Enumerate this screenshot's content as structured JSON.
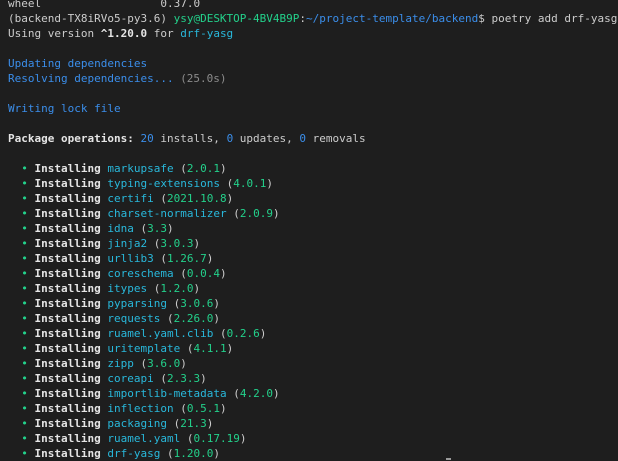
{
  "wheel_line": {
    "name": "wheel",
    "version": "0.37.0"
  },
  "prompt": {
    "venv": "(backend-TX8iRVo5-py3.6)",
    "user_host": "ysy@DESKTOP-4BV4B9P",
    "colon": ":",
    "path": "~/project-template/backend",
    "dollar": "$",
    "command": "poetry add drf-yasg"
  },
  "using": {
    "prefix": "Using version ",
    "constraint": "^1.20.0",
    "middle": " for ",
    "package": "drf-yasg"
  },
  "updating": "Updating dependencies",
  "resolving": {
    "text": "Resolving dependencies... ",
    "time": "(25.0s)"
  },
  "writing": "Writing lock file",
  "operations": {
    "label": "Package operations: ",
    "installs": "20",
    "installs_label": " installs, ",
    "updates": "0",
    "updates_label": " updates, ",
    "removals": "0",
    "removals_label": " removals"
  },
  "install_word": "Installing",
  "bullet": "•",
  "packages": [
    {
      "name": "markupsafe",
      "version": "2.0.1"
    },
    {
      "name": "typing-extensions",
      "version": "4.0.1"
    },
    {
      "name": "certifi",
      "version": "2021.10.8"
    },
    {
      "name": "charset-normalizer",
      "version": "2.0.9"
    },
    {
      "name": "idna",
      "version": "3.3"
    },
    {
      "name": "jinja2",
      "version": "3.0.3"
    },
    {
      "name": "urllib3",
      "version": "1.26.7"
    },
    {
      "name": "coreschema",
      "version": "0.0.4"
    },
    {
      "name": "itypes",
      "version": "1.2.0"
    },
    {
      "name": "pyparsing",
      "version": "3.0.6"
    },
    {
      "name": "requests",
      "version": "2.26.0"
    },
    {
      "name": "ruamel.yaml.clib",
      "version": "0.2.6"
    },
    {
      "name": "uritemplate",
      "version": "4.1.1"
    },
    {
      "name": "zipp",
      "version": "3.6.0"
    },
    {
      "name": "coreapi",
      "version": "2.3.3"
    },
    {
      "name": "importlib-metadata",
      "version": "4.2.0"
    },
    {
      "name": "inflection",
      "version": "0.5.1"
    },
    {
      "name": "packaging",
      "version": "21.3"
    },
    {
      "name": "ruamel.yaml",
      "version": "0.17.19"
    },
    {
      "name": "drf-yasg",
      "version": "1.20.0"
    }
  ],
  "colors": {
    "background": "#1e1e1e",
    "text": "#cccccc",
    "green": "#23d18b",
    "blue": "#3b8eea",
    "cyan": "#29b8db",
    "gray": "#8c8c8c"
  }
}
